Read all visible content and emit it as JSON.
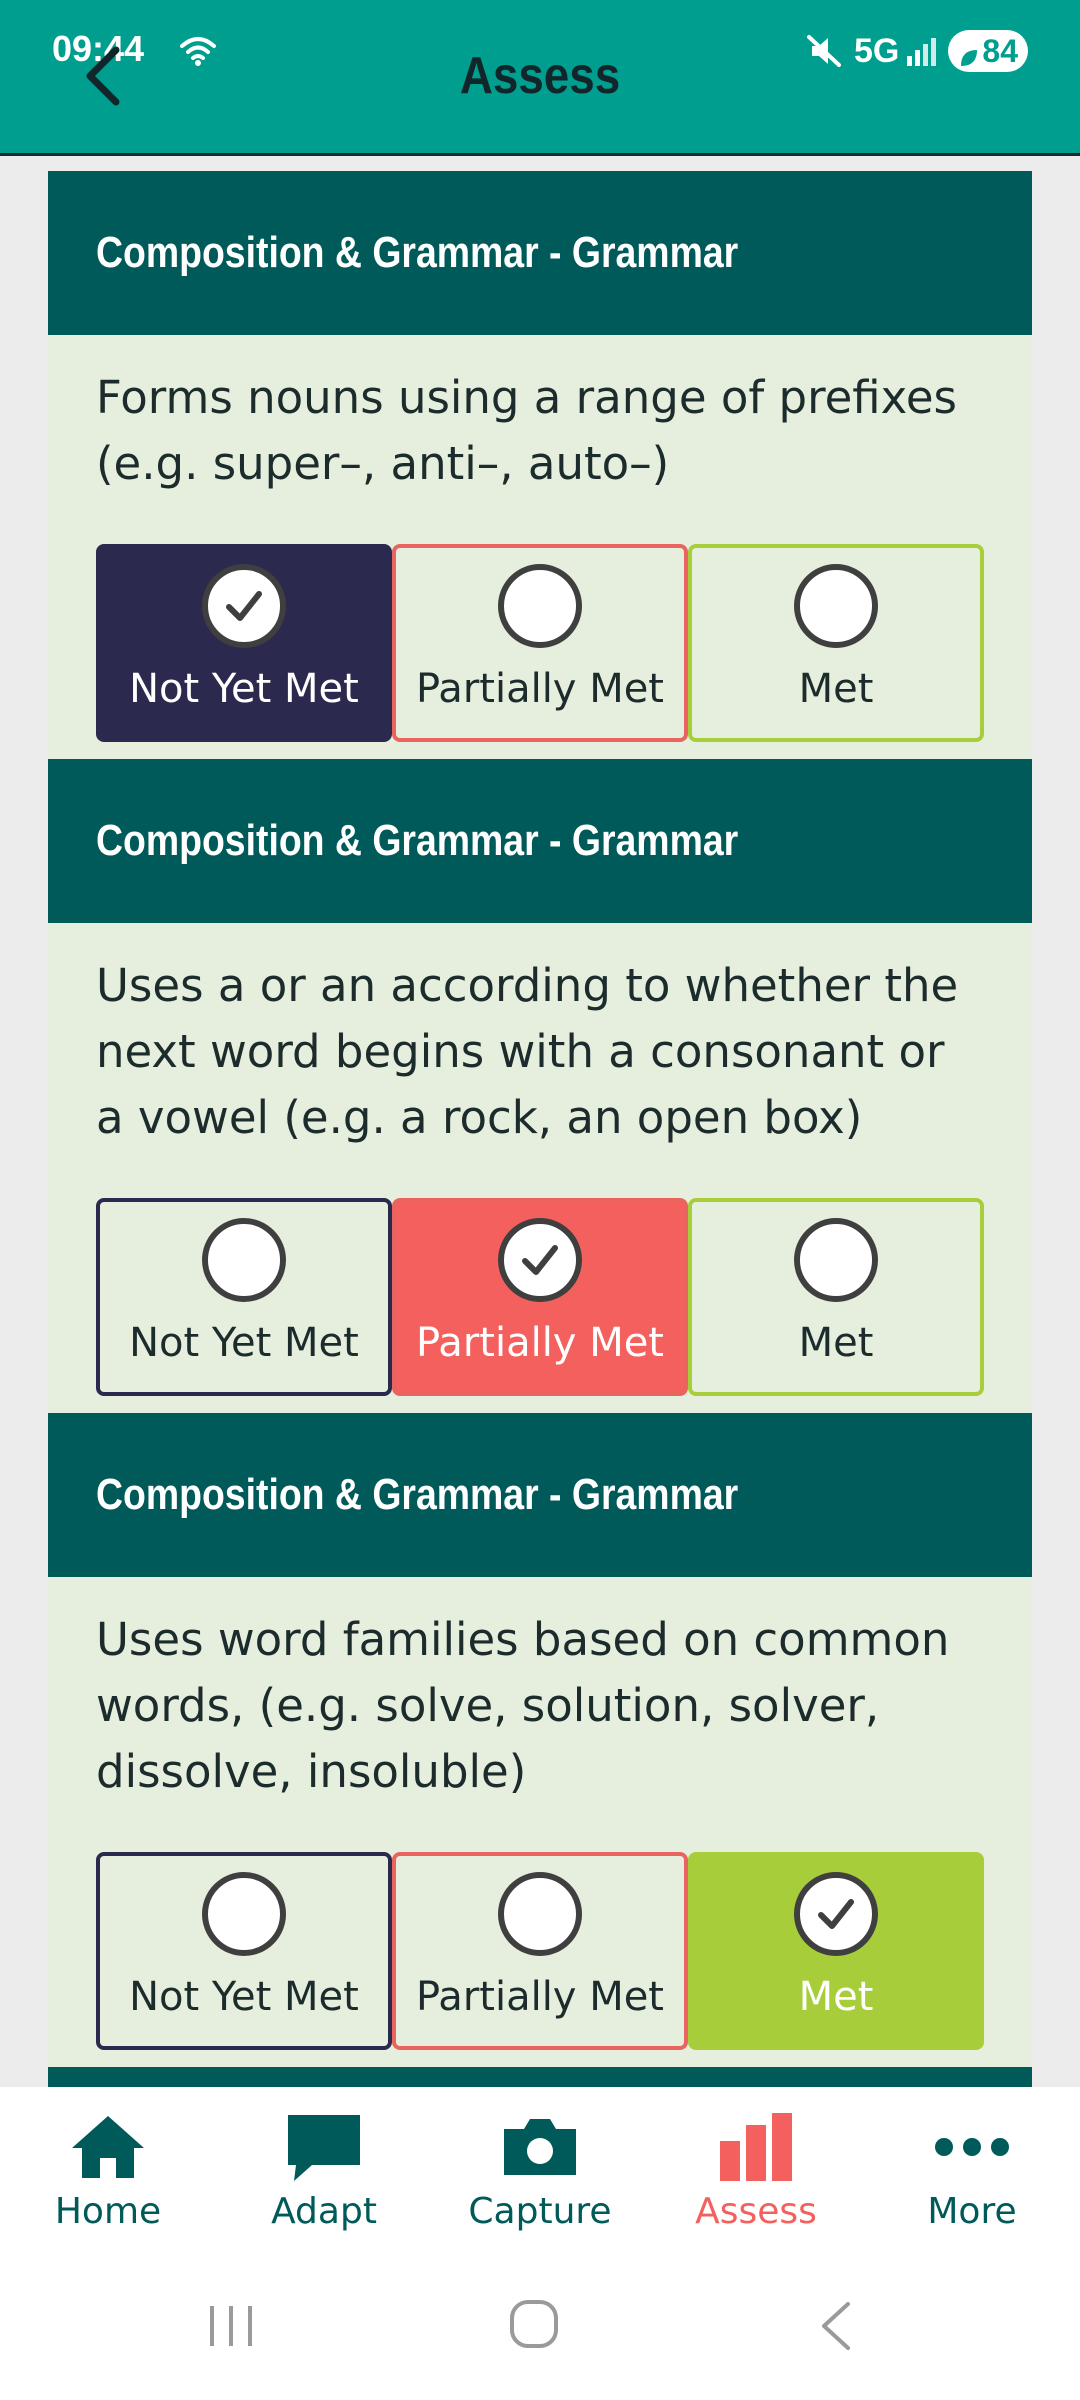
{
  "status_bar": {
    "time": "09:44",
    "network": "5G",
    "battery": "84",
    "icons": [
      "wifi-icon",
      "mute-icon",
      "signal-icon",
      "battery-icon"
    ]
  },
  "header": {
    "title": "Assess",
    "back_icon": "chevron-left-icon",
    "background_color": "#009e8f"
  },
  "cards": [
    {
      "category": "Composition & Grammar - Grammar",
      "description": "Forms nouns using a range of prefixes (e.g. super–, anti–, auto–)",
      "options": [
        "Not Yet Met",
        "Partially Met",
        "Met"
      ],
      "selected": "Not Yet Met"
    },
    {
      "category": "Composition & Grammar - Grammar",
      "description": "Uses a or an according to whether the next word begins with a consonant or a vowel (e.g. a rock, an open box)",
      "options": [
        "Not Yet Met",
        "Partially Met",
        "Met"
      ],
      "selected": "Partially Met"
    },
    {
      "category": "Composition & Grammar - Grammar",
      "description": "Uses word families based on common words, (e.g. solve, solution, solver, dissolve, insoluble)",
      "options": [
        "Not Yet Met",
        "Partially Met",
        "Met"
      ],
      "selected": "Met"
    }
  ],
  "bottom_nav": {
    "items": [
      {
        "label": "Home",
        "icon": "home-icon"
      },
      {
        "label": "Adapt",
        "icon": "chat-bubble-icon"
      },
      {
        "label": "Capture",
        "icon": "camera-icon"
      },
      {
        "label": "Assess",
        "icon": "bar-chart-icon"
      },
      {
        "label": "More",
        "icon": "more-dots-icon"
      }
    ],
    "active": "Assess"
  },
  "colors": {
    "card_header": "#005a5a",
    "card_body": "#e6efde",
    "not_yet_met": "#2b2a4e",
    "partially_met": "#f4605d",
    "met": "#a7cd3a",
    "nav_active": "#f4605d",
    "nav_default": "#005a5a"
  }
}
